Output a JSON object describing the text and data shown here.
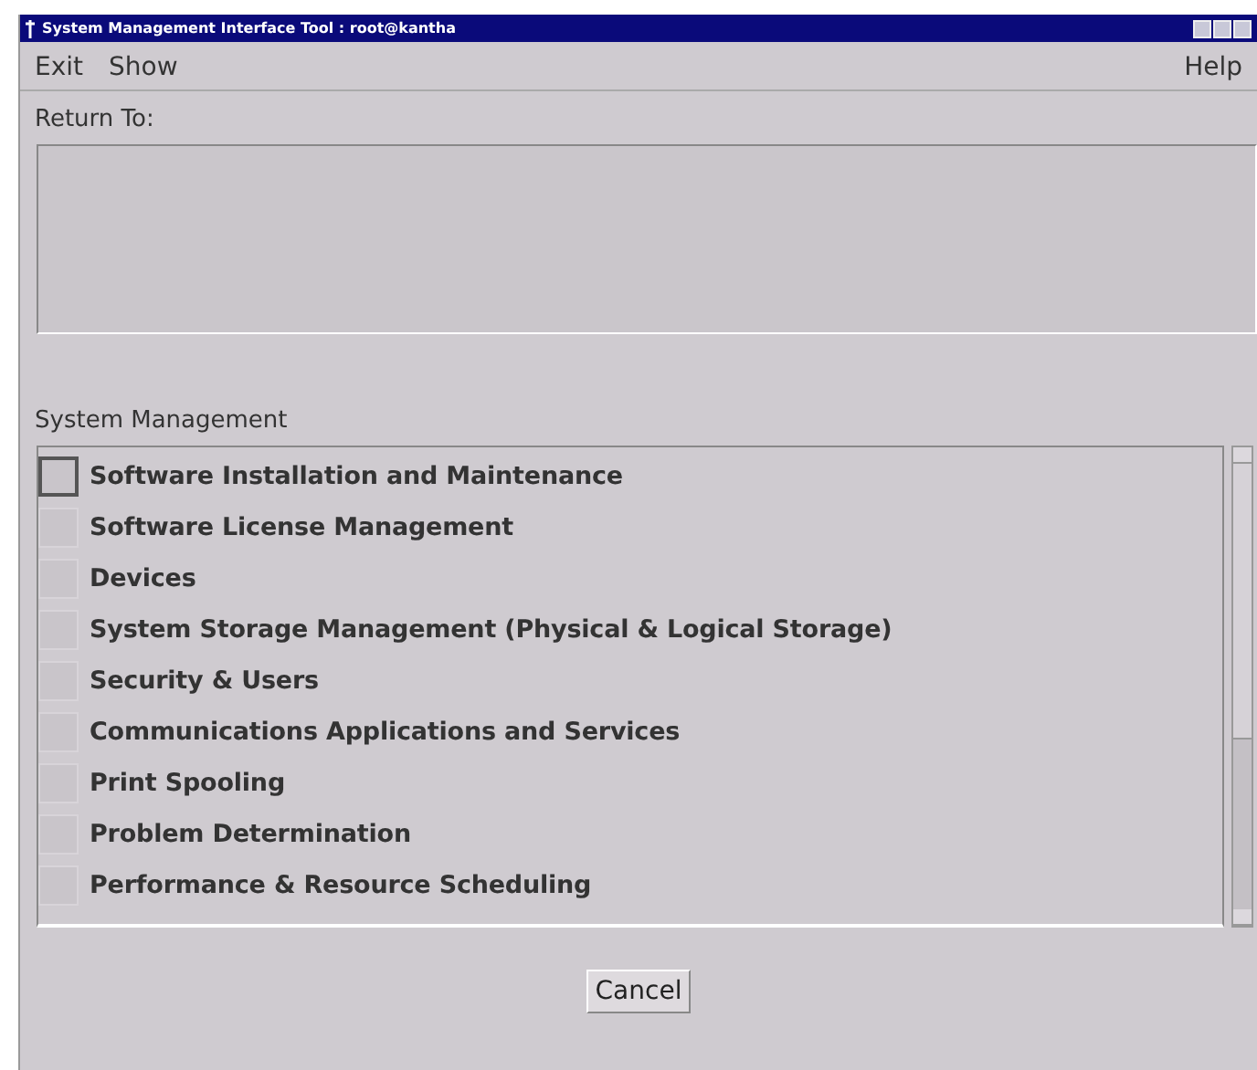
{
  "window": {
    "title": "System Management Interface Tool : root@kantha"
  },
  "menu": {
    "left": [
      {
        "label": "Exit"
      },
      {
        "label": "Show"
      }
    ],
    "right": [
      {
        "label": "Help"
      }
    ]
  },
  "return_to": {
    "label": "Return To:"
  },
  "system_management": {
    "label": "System Management",
    "items": [
      {
        "label": "Software Installation and Maintenance",
        "selected": true
      },
      {
        "label": "Software License Management",
        "selected": false
      },
      {
        "label": "Devices",
        "selected": false
      },
      {
        "label": "System Storage Management (Physical & Logical Storage)",
        "selected": false
      },
      {
        "label": "Security & Users",
        "selected": false
      },
      {
        "label": "Communications Applications and Services",
        "selected": false
      },
      {
        "label": "Print Spooling",
        "selected": false
      },
      {
        "label": "Problem Determination",
        "selected": false
      },
      {
        "label": "Performance & Resource Scheduling",
        "selected": false
      }
    ]
  },
  "buttons": [
    {
      "label": "Cancel"
    }
  ]
}
